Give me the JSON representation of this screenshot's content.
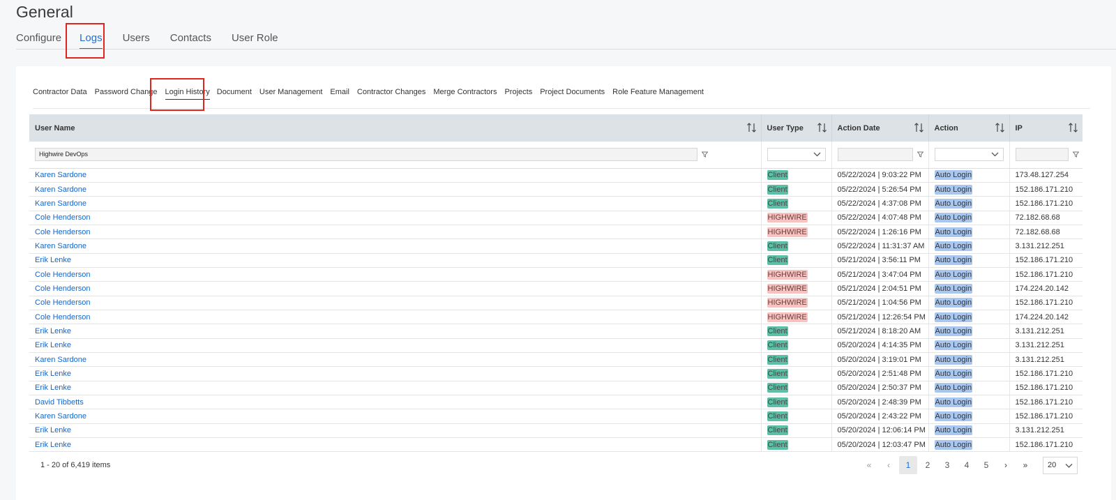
{
  "page": {
    "title": "General"
  },
  "main_tabs": [
    "Configure",
    "Logs",
    "Users",
    "Contacts",
    "User Role"
  ],
  "sub_tabs": [
    "Contractor Data",
    "Password Change",
    "Login History",
    "Document",
    "User Management",
    "Email",
    "Contractor Changes",
    "Merge Contractors",
    "Projects",
    "Project Documents",
    "Role Feature Management"
  ],
  "grid": {
    "columns": [
      "User Name",
      "User Type",
      "Action Date",
      "Action",
      "IP"
    ],
    "filters": {
      "user_name": "Highwire DevOps",
      "user_type": "",
      "action_date": "",
      "action": "",
      "ip": ""
    },
    "rows": [
      [
        "Karen Sardone",
        "Client",
        "05/22/2024 | 9:03:22 PM",
        "Auto Login",
        "173.48.127.254"
      ],
      [
        "Karen Sardone",
        "Client",
        "05/22/2024 | 5:26:54 PM",
        "Auto Login",
        "152.186.171.210"
      ],
      [
        "Karen Sardone",
        "Client",
        "05/22/2024 | 4:37:08 PM",
        "Auto Login",
        "152.186.171.210"
      ],
      [
        "Cole Henderson",
        "HIGHWIRE",
        "05/22/2024 | 4:07:48 PM",
        "Auto Login",
        "72.182.68.68"
      ],
      [
        "Cole Henderson",
        "HIGHWIRE",
        "05/22/2024 | 1:26:16 PM",
        "Auto Login",
        "72.182.68.68"
      ],
      [
        "Karen Sardone",
        "Client",
        "05/22/2024 | 11:31:37 AM",
        "Auto Login",
        "3.131.212.251"
      ],
      [
        "Erik Lenke",
        "Client",
        "05/21/2024 | 3:56:11 PM",
        "Auto Login",
        "152.186.171.210"
      ],
      [
        "Cole Henderson",
        "HIGHWIRE",
        "05/21/2024 | 3:47:04 PM",
        "Auto Login",
        "152.186.171.210"
      ],
      [
        "Cole Henderson",
        "HIGHWIRE",
        "05/21/2024 | 2:04:51 PM",
        "Auto Login",
        "174.224.20.142"
      ],
      [
        "Cole Henderson",
        "HIGHWIRE",
        "05/21/2024 | 1:04:56 PM",
        "Auto Login",
        "152.186.171.210"
      ],
      [
        "Cole Henderson",
        "HIGHWIRE",
        "05/21/2024 | 12:26:54 PM",
        "Auto Login",
        "174.224.20.142"
      ],
      [
        "Erik Lenke",
        "Client",
        "05/21/2024 | 8:18:20 AM",
        "Auto Login",
        "3.131.212.251"
      ],
      [
        "Erik Lenke",
        "Client",
        "05/20/2024 | 4:14:35 PM",
        "Auto Login",
        "3.131.212.251"
      ],
      [
        "Karen Sardone",
        "Client",
        "05/20/2024 | 3:19:01 PM",
        "Auto Login",
        "3.131.212.251"
      ],
      [
        "Erik Lenke",
        "Client",
        "05/20/2024 | 2:51:48 PM",
        "Auto Login",
        "152.186.171.210"
      ],
      [
        "Erik Lenke",
        "Client",
        "05/20/2024 | 2:50:37 PM",
        "Auto Login",
        "152.186.171.210"
      ],
      [
        "David Tibbetts",
        "Client",
        "05/20/2024 | 2:48:39 PM",
        "Auto Login",
        "152.186.171.210"
      ],
      [
        "Karen Sardone",
        "Client",
        "05/20/2024 | 2:43:22 PM",
        "Auto Login",
        "152.186.171.210"
      ],
      [
        "Erik Lenke",
        "Client",
        "05/20/2024 | 12:06:14 PM",
        "Auto Login",
        "3.131.212.251"
      ],
      [
        "Erik Lenke",
        "Client",
        "05/20/2024 | 12:03:47 PM",
        "Auto Login",
        "152.186.171.210"
      ]
    ]
  },
  "pagination": {
    "summary": "1 - 20 of 6,419 items",
    "first": "«",
    "prev": "‹",
    "pages": [
      "1",
      "2",
      "3",
      "4",
      "5"
    ],
    "next": "›",
    "last": "»",
    "page_size": "20"
  },
  "colors": {
    "accent": "#1f6fd1",
    "client_tag": "#5bc0a6",
    "highwire_tag": "#f6c3c0",
    "action_tag": "#a8c6ee",
    "highlight": "#e3241d"
  }
}
